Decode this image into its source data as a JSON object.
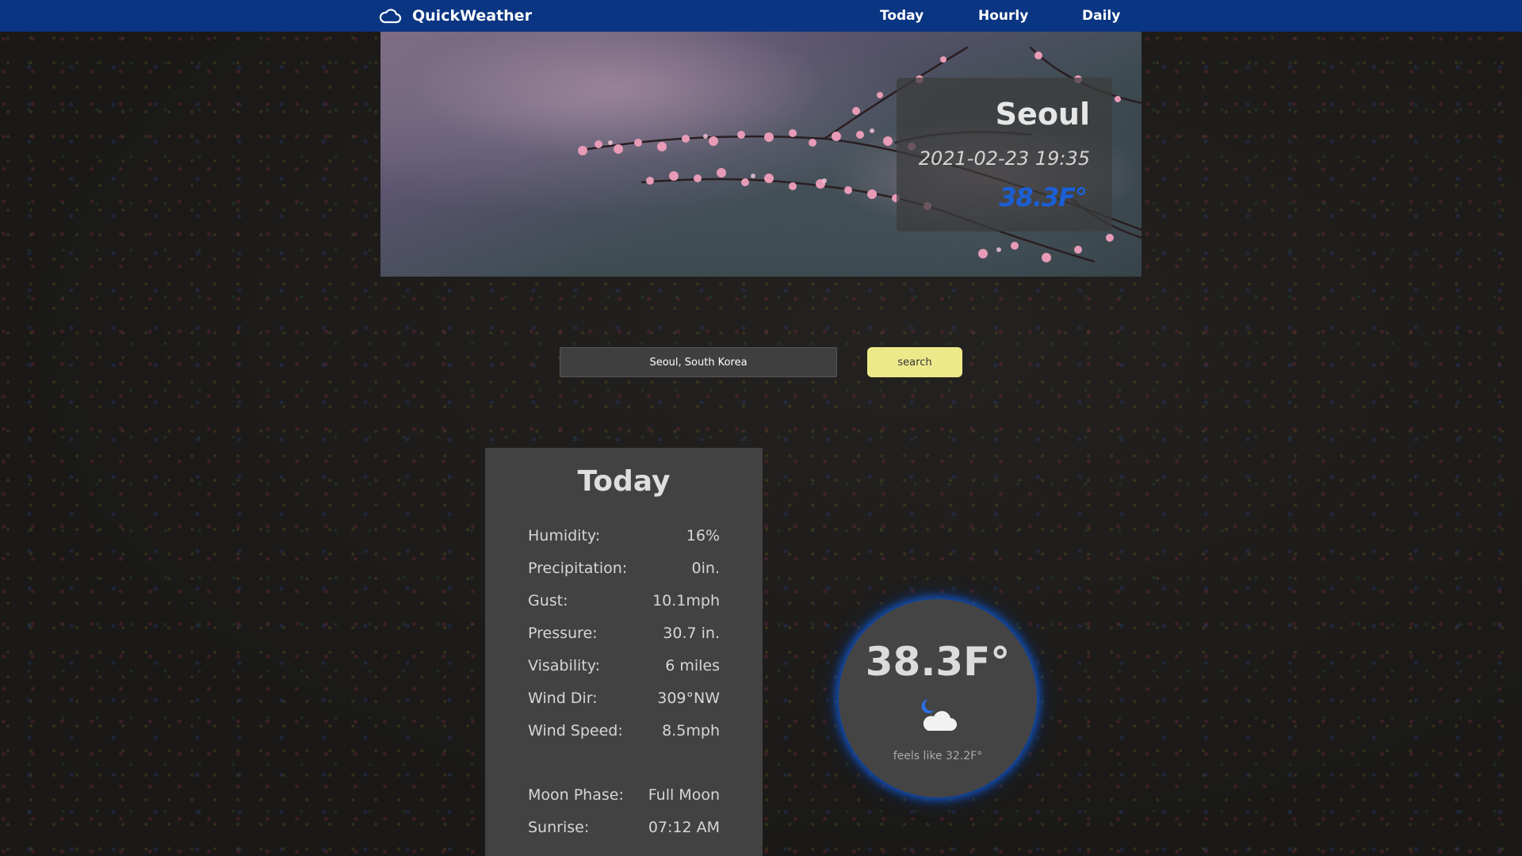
{
  "nav": {
    "brand": "QuickWeather",
    "links": [
      "Today",
      "Hourly",
      "Daily"
    ]
  },
  "hero": {
    "city": "Seoul",
    "datetime": "2021-02-23 19:35",
    "temp": "38.3F°"
  },
  "search": {
    "value": "Seoul, South Korea",
    "button": "search"
  },
  "today": {
    "title": "Today",
    "rows": [
      {
        "label": "Humidity:",
        "value": "16%"
      },
      {
        "label": "Precipitation:",
        "value": "0in."
      },
      {
        "label": "Gust:",
        "value": "10.1mph"
      },
      {
        "label": "Pressure:",
        "value": "30.7 in."
      },
      {
        "label": "Visability:",
        "value": "6 miles"
      },
      {
        "label": "Wind Dir:",
        "value": "309°NW"
      },
      {
        "label": "Wind Speed:",
        "value": "8.5mph"
      },
      {
        "label": "Moon Phase:",
        "value": "Full Moon"
      },
      {
        "label": "Sunrise:",
        "value": "07:12 AM"
      }
    ]
  },
  "current": {
    "temp": "38.3F°",
    "feels_like": "feels like 32.2F°",
    "icon": "night-cloudy-icon"
  },
  "colors": {
    "navbar": "#0a3582",
    "accent_blue": "#1b5fd6",
    "search_button": "#ede98a",
    "panel": "#424242"
  }
}
